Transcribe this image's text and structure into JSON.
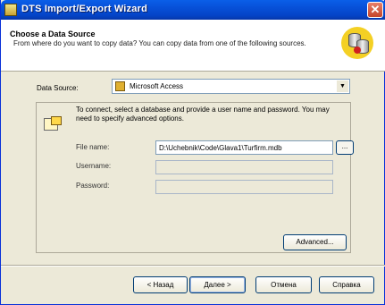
{
  "window": {
    "title": "DTS Import/Export Wizard"
  },
  "header": {
    "title": "Choose a Data Source",
    "description": "From where do you want to copy data? You can copy data from one of the following sources."
  },
  "data_source": {
    "label": "Data Source:",
    "selected": "Microsoft Access",
    "icon": "key-icon"
  },
  "connection": {
    "instructions": "To connect, select a database and provide a user name and password. You may need to specify advanced options.",
    "file_name_label": "File name:",
    "file_name_value": "D:\\Uchebnik\\Code\\Glava1\\Turfirm.mdb",
    "browse_label": "...",
    "username_label": "Username:",
    "username_value": "",
    "password_label": "Password:",
    "password_value": "",
    "advanced_label": "Advanced..."
  },
  "buttons": {
    "back": "< Назад",
    "next": "Далее >",
    "cancel": "Отмена",
    "help": "Справка"
  }
}
